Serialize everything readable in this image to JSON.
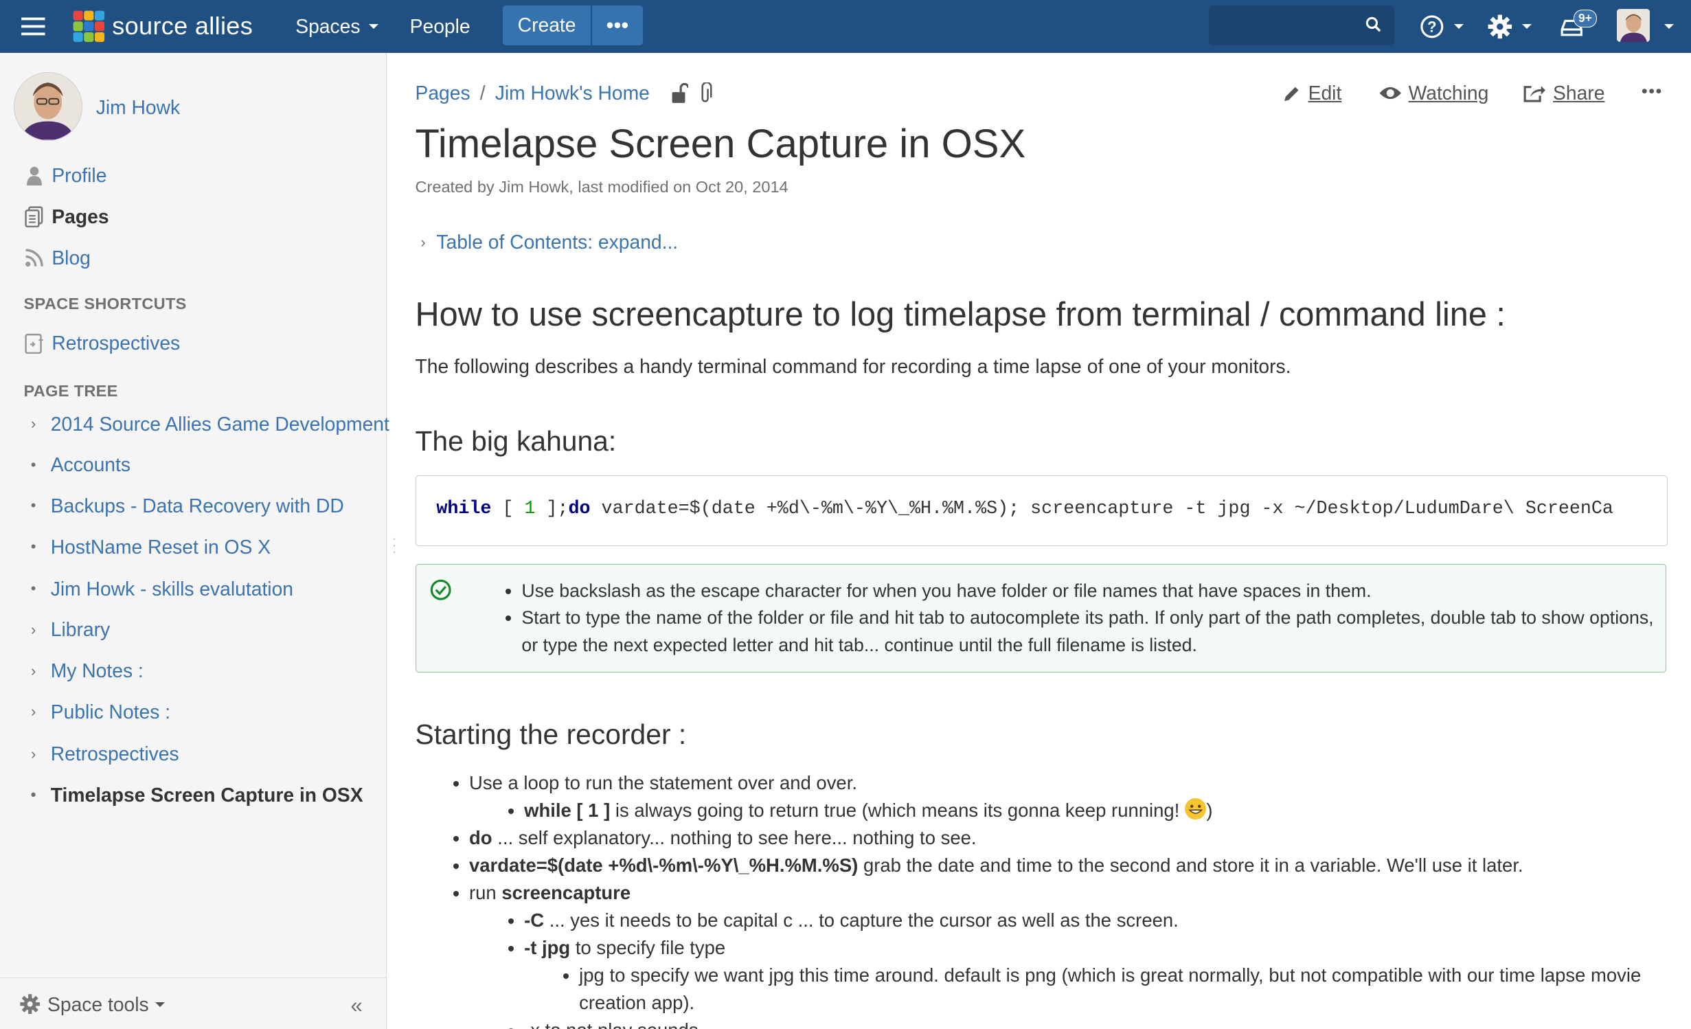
{
  "topbar": {
    "logo_text": "source allies",
    "nav_spaces": "Spaces",
    "nav_people": "People",
    "create_label": "Create",
    "more_label": "•••",
    "search_placeholder": "",
    "notification_count": "9+",
    "colors": {
      "bar": "#205081",
      "button": "#3572b0",
      "search": "#1b4570"
    }
  },
  "sidebar": {
    "user_name": "Jim Howk",
    "links": [
      {
        "label": "Profile",
        "icon": "person-icon"
      },
      {
        "label": "Pages",
        "icon": "pages-icon"
      },
      {
        "label": "Blog",
        "icon": "rss-icon"
      }
    ],
    "shortcuts_heading": "SPACE SHORTCUTS",
    "shortcut": "Retrospectives",
    "page_tree_heading": "PAGE TREE",
    "tree": [
      {
        "label": "2014 Source Allies Game Development",
        "marker": "chevron"
      },
      {
        "label": "Accounts",
        "marker": "bullet"
      },
      {
        "label": "Backups - Data Recovery with DD",
        "marker": "bullet"
      },
      {
        "label": "HostName Reset in OS X",
        "marker": "bullet"
      },
      {
        "label": "Jim Howk - skills evalutation",
        "marker": "bullet"
      },
      {
        "label": "Library",
        "marker": "chevron"
      },
      {
        "label": "My Notes :",
        "marker": "chevron"
      },
      {
        "label": "Public Notes :",
        "marker": "chevron"
      },
      {
        "label": "Retrospectives",
        "marker": "chevron"
      },
      {
        "label": "Timelapse Screen Capture in OSX",
        "marker": "bullet"
      }
    ],
    "space_tools": "Space tools",
    "collapse_label": "«"
  },
  "page": {
    "breadcrumb": [
      "Pages",
      "Jim Howk's Home"
    ],
    "breadcrumb_sep": "/",
    "actions": {
      "edit": "Edit",
      "watching": "Watching",
      "share": "Share",
      "more": "•••"
    },
    "title": "Timelapse Screen Capture in OSX",
    "meta": "Created by Jim Howk, last modified on Oct 20, 2014",
    "toc": "Table of Contents: expand...",
    "h_howto": "How to use screencapture to log timelapse from terminal / command line :",
    "intro": "The following describes a handy terminal command for recording a time lapse of one of your monitors.",
    "h_kahuna": "The big kahuna:",
    "code": {
      "kw_while": "while",
      "part1": " [ ",
      "num": "1",
      "part2": " ];",
      "kw_do": "do",
      "rest": " vardate=$(date +%d\\-%m\\-%Y\\_%H.%M.%S); screencapture -t jpg -x ~/Desktop/LudumDare\\ ScreenCa"
    },
    "tips": [
      "Use backslash as the escape character for when you have folder or file names that have spaces in them.",
      "Start to type the name of the folder or file and hit tab to autocomplete its path. If only part of the path completes, double tab to show options, or type the next expected letter and hit tab... continue until the full filename is listed."
    ],
    "h_start": "Starting the recorder :",
    "steps": {
      "loop": "Use a loop to run the statement over and over.",
      "while_bold": "while [ 1 ]",
      "while_rest": " is always going to return true (which means its gonna keep running! ",
      "while_end": ")",
      "do_bold": "do",
      "do_rest": " ... self explanatory... nothing to see here... nothing to see.",
      "vardate_bold": "vardate=$(date +%d\\-%m\\-%Y\\_%H.%M.%S)",
      "vardate_rest": " grab the date and time to the second and store it in a variable. We'll use it later.",
      "run": "run ",
      "run_bold": "screencapture",
      "c_bold": "-C",
      "c_rest": " ... yes it needs to be capital c ... to capture the cursor as well as the screen.",
      "t_bold": "-t jpg",
      "t_rest": " to specify file type",
      "jpg_note": "jpg to specify we want jpg this time around. default is png (which is great normally, but not compatible with our time lapse movie creation app).",
      "x_partial": "-x to not play sounds"
    }
  }
}
